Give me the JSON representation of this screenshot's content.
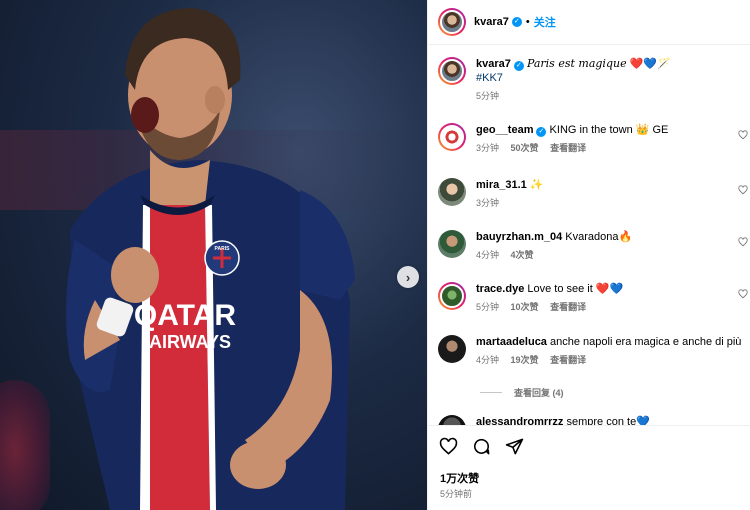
{
  "photo": {
    "jersey_sponsor_line1": "QATAR",
    "jersey_sponsor_line2": "AIRWAYS",
    "badge_text": "PARIS",
    "carousel_next_icon": "chevron-right-icon"
  },
  "header": {
    "username": "kvara7",
    "verified_icon": "verified-badge-icon",
    "follow_label": "关注"
  },
  "caption": {
    "username": "kvara7",
    "text": "Paris est magique",
    "emojis": "❤️💙🪄",
    "hashtag": "#KK7",
    "time": "5分钟"
  },
  "comments": [
    {
      "username": "geo__team",
      "verified": true,
      "text": "KING in the town 👑 GE",
      "time": "3分钟",
      "likes": "50次赞",
      "translate": "查看翻译"
    },
    {
      "username": "mira_31.1",
      "verified": false,
      "text": "✨",
      "time": "3分钟",
      "likes": "",
      "translate": ""
    },
    {
      "username": "bauyrzhan.m_04",
      "verified": false,
      "text": "Kvaradona🔥",
      "time": "4分钟",
      "likes": "4次赞",
      "translate": ""
    },
    {
      "username": "trace.dye",
      "verified": false,
      "text": "Love to see it ❤️💙",
      "time": "5分钟",
      "likes": "10次赞",
      "translate": "查看翻译"
    },
    {
      "username": "martaadeluca",
      "verified": false,
      "text": "anche napoli era magica e anche di più",
      "time": "4分钟",
      "likes": "19次赞",
      "translate": "查看翻译"
    },
    {
      "username": "alessandromrrzz",
      "verified": false,
      "text": "sempre con te💙",
      "time": "",
      "likes": "",
      "translate": ""
    }
  ],
  "replies_label": "查看回复 (4)",
  "actions": {
    "like_icon": "heart-icon",
    "comment_icon": "comment-icon",
    "share_icon": "send-icon",
    "likes_count": "1万次赞",
    "posted_time": "5分钟前"
  }
}
